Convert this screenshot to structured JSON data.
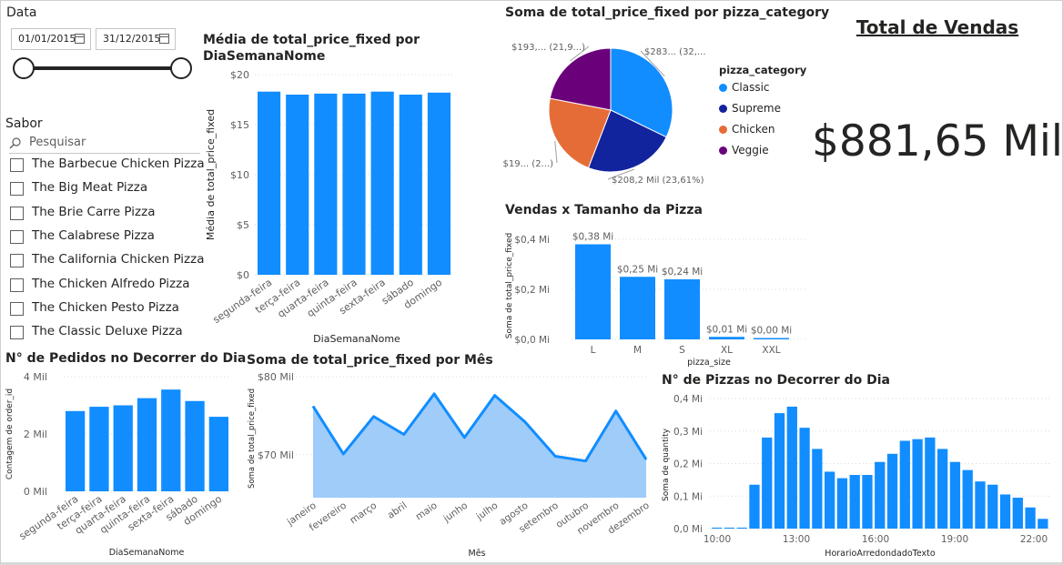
{
  "colors": {
    "bar": "#118DFF",
    "area_fill": "#9FCCF9",
    "classic": "#118DFF",
    "supreme": "#12239E",
    "chicken": "#E66C37",
    "veggie": "#6B007B"
  },
  "data_slicer": {
    "title": "Data",
    "start": "01/01/2015",
    "end": "31/12/2015",
    "start_icon": "calendar-icon",
    "end_icon": "calendar-icon"
  },
  "flavor_slicer": {
    "title": "Sabor",
    "search_placeholder": "Pesquisar",
    "items": [
      "The Barbecue Chicken Pizza",
      "The Big Meat Pizza",
      "The Brie Carre Pizza",
      "The Calabrese Pizza",
      "The California Chicken Pizza",
      "The Chicken Alfredo Pizza",
      "The Chicken Pesto Pizza",
      "The Classic Deluxe Pizza"
    ]
  },
  "kpi": {
    "title": "Total de Vendas",
    "value": "$881,65 Mil"
  },
  "charts": {
    "weekday_avg": {
      "title_line1": "Média de total_price_fixed por",
      "title_line2": "DiaSemanaNome",
      "xlabel": "DiaSemanaNome",
      "ylabel": "Média de total_price_fixed",
      "yticks": [
        "$20",
        "$15",
        "$10",
        "$5",
        "$0"
      ]
    },
    "pie": {
      "title": "Soma de total_price_fixed por pizza_category",
      "legend_title": "pizza_category",
      "labels": {
        "classic": "$283... (32,...",
        "supreme": "$208,2 Mil (23,61%)",
        "chicken": "$19... (2...)",
        "veggie": "$193,... (21,9...)"
      }
    },
    "size": {
      "title": "Vendas x Tamanho da Pizza",
      "xlabel": "pizza_size",
      "ylabel": "Soma de total_price_fixed",
      "yticks": [
        "$0,4 Mi",
        "$0,2 Mi",
        "$0,0 Mi"
      ]
    },
    "orders_day": {
      "title": "N° de Pedidos no Decorrer do Dia",
      "xlabel": "DiaSemanaNome",
      "ylabel": "Contagem de order_id",
      "yticks": [
        "4 Mil",
        "2 Mil",
        "0 Mil"
      ]
    },
    "month": {
      "title": "Soma de total_price_fixed por Mês",
      "xlabel": "Mês",
      "ylabel": "Soma de total_price_fixed",
      "yticks": [
        "$80 Mil",
        "$70 Mil"
      ]
    },
    "hourly": {
      "title": "N° de Pizzas no Decorrer do Dia",
      "xlabel": "HorarioArredondadoTexto",
      "ylabel": "Soma de quantity",
      "yticks": [
        "0,4 Mi",
        "0,3 Mi",
        "0,2 Mi",
        "0,1 Mi",
        "0,0 Mi"
      ],
      "xticks": [
        "10:00",
        "13:00",
        "16:00",
        "19:00",
        "22:00"
      ]
    }
  },
  "chart_data": [
    {
      "type": "bar",
      "title": "Média de total_price_fixed por DiaSemanaNome",
      "categories": [
        "segunda-feira",
        "terça-feira",
        "quarta-feira",
        "quinta-feira",
        "sexta-feira",
        "sábado",
        "domingo"
      ],
      "values": [
        18.3,
        18.0,
        18.1,
        18.1,
        18.3,
        18.0,
        18.2
      ],
      "xlabel": "DiaSemanaNome",
      "ylabel": "Média de total_price_fixed",
      "ylim": [
        0,
        20
      ]
    },
    {
      "type": "pie",
      "title": "Soma de total_price_fixed por pizza_category",
      "categories": [
        "Classic",
        "Supreme",
        "Chicken",
        "Veggie"
      ],
      "values": [
        283,
        208.2,
        195,
        193
      ],
      "legend": "right"
    },
    {
      "type": "bar",
      "title": "Vendas x Tamanho da Pizza",
      "categories": [
        "L",
        "M",
        "S",
        "XL",
        "XXL"
      ],
      "values": [
        0.38,
        0.25,
        0.24,
        0.01,
        0.0
      ],
      "data_labels": [
        "$0,38 Mi",
        "$0,25 Mi",
        "$0,24 Mi",
        "$0,01 Mi",
        "$0,00 Mi"
      ],
      "xlabel": "pizza_size",
      "ylabel": "Soma de total_price_fixed",
      "ylim": [
        0,
        0.45
      ]
    },
    {
      "type": "bar",
      "title": "N° de Pedidos no Decorrer do Dia",
      "categories": [
        "segunda-feira",
        "terça-feira",
        "quarta-feira",
        "quinta-feira",
        "sexta-feira",
        "sábado",
        "domingo"
      ],
      "values": [
        2.8,
        2.95,
        3.0,
        3.25,
        3.55,
        3.15,
        2.6
      ],
      "xlabel": "DiaSemanaNome",
      "ylabel": "Contagem de order_id",
      "ylim": [
        0,
        4
      ]
    },
    {
      "type": "area",
      "title": "Soma de total_price_fixed por Mês",
      "categories": [
        "janeiro",
        "fevereiro",
        "março",
        "abril",
        "maio",
        "junho",
        "julho",
        "agosto",
        "setembro",
        "outubro",
        "novembro",
        "dezembro"
      ],
      "values": [
        76.2,
        70.1,
        74.9,
        72.6,
        77.8,
        72.2,
        77.6,
        74.2,
        69.8,
        69.2,
        75.6,
        69.4
      ],
      "xlabel": "Mês",
      "ylabel": "Soma de total_price_fixed",
      "ylim": [
        64.5,
        80
      ]
    },
    {
      "type": "bar",
      "title": "N° de Pizzas no Decorrer do Dia",
      "categories": [
        "09:00",
        "09:30",
        "10:00",
        "10:30",
        "11:00",
        "11:30",
        "12:00",
        "12:30",
        "13:00",
        "13:30",
        "14:00",
        "14:30",
        "15:00",
        "15:30",
        "16:00",
        "16:30",
        "17:00",
        "17:30",
        "18:00",
        "18:30",
        "19:00",
        "19:30",
        "20:00",
        "20:30",
        "21:00",
        "21:30",
        "22:00",
        "22:30",
        "23:00"
      ],
      "values": [
        0.003,
        0.003,
        0.003,
        0.135,
        0.28,
        0.355,
        0.375,
        0.31,
        0.245,
        0.175,
        0.155,
        0.165,
        0.165,
        0.205,
        0.23,
        0.27,
        0.275,
        0.28,
        0.245,
        0.205,
        0.18,
        0.145,
        0.135,
        0.105,
        0.095,
        0.065,
        0.03
      ],
      "xlabel": "HorarioArredondadoTexto",
      "ylabel": "Soma de quantity",
      "ylim": [
        0,
        0.4
      ]
    }
  ]
}
